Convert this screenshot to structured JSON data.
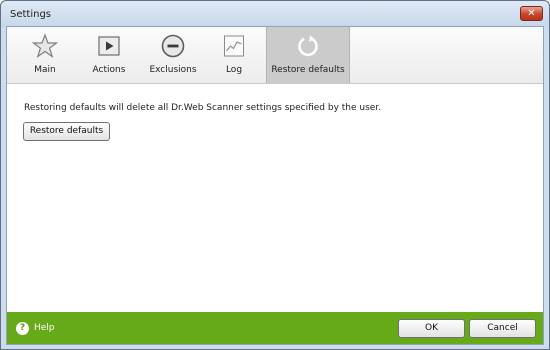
{
  "window": {
    "title": "Settings",
    "close_glyph": "✕"
  },
  "toolbar": {
    "items": [
      {
        "label": "Main",
        "icon": "star-icon",
        "active": false
      },
      {
        "label": "Actions",
        "icon": "play-icon",
        "active": false
      },
      {
        "label": "Exclusions",
        "icon": "minus-circle-icon",
        "active": false
      },
      {
        "label": "Log",
        "icon": "log-chart-icon",
        "active": false
      },
      {
        "label": "Restore defaults",
        "icon": "restore-icon",
        "active": true
      }
    ]
  },
  "content": {
    "description": "Restoring defaults will delete all Dr.Web Scanner settings specified by the user.",
    "restore_button_label": "Restore defaults"
  },
  "footer": {
    "help_label": "Help",
    "help_glyph": "?",
    "ok_label": "OK",
    "cancel_label": "Cancel",
    "background_color": "#67aa19"
  }
}
